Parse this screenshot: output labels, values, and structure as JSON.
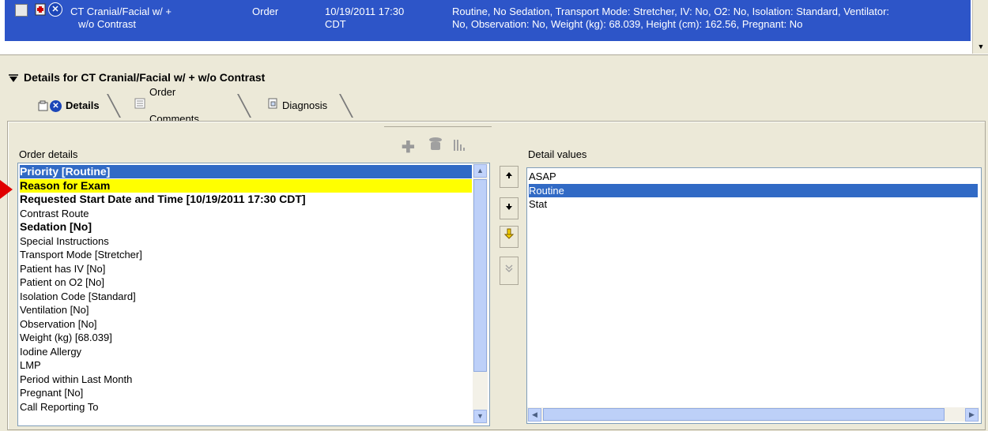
{
  "order_row": {
    "name_line1": "CT Cranial/Facial w/ +",
    "name_line2": "w/o Contrast",
    "type": "Order",
    "datetime_line1": "10/19/2011 17:30",
    "datetime_line2": "CDT",
    "summary_line1": "Routine, No Sedation, Transport Mode: Stretcher, IV: No, O2: No, Isolation: Standard, Ventilator:",
    "summary_line2": "No, Observation: No, Weight (kg): 68.039, Height (cm): 162.56, Pregnant: No"
  },
  "details": {
    "title": "Details for CT Cranial/Facial w/ + w/o Contrast",
    "tabs": [
      {
        "label": "Details",
        "icon": "details-icon"
      },
      {
        "label": "Order Comments",
        "icon": "comments-icon"
      },
      {
        "label": "Diagnosis",
        "icon": "diagnosis-icon"
      }
    ]
  },
  "order_details": {
    "label": "Order details",
    "items": [
      {
        "text": "Priority   [Routine]",
        "bold": true,
        "state": "selected"
      },
      {
        "text": "Reason for Exam",
        "bold": true,
        "state": "required"
      },
      {
        "text": "Requested Start Date and Time   [10/19/2011 17:30 CDT]",
        "bold": true,
        "state": ""
      },
      {
        "text": "Contrast Route",
        "bold": false,
        "state": ""
      },
      {
        "text": "Sedation   [No]",
        "bold": true,
        "state": ""
      },
      {
        "text": "Special Instructions",
        "bold": false,
        "state": ""
      },
      {
        "text": "Transport Mode   [Stretcher]",
        "bold": false,
        "state": ""
      },
      {
        "text": "Patient has IV   [No]",
        "bold": false,
        "state": ""
      },
      {
        "text": "Patient on O2   [No]",
        "bold": false,
        "state": ""
      },
      {
        "text": "Isolation Code   [Standard]",
        "bold": false,
        "state": ""
      },
      {
        "text": "Ventilation   [No]",
        "bold": false,
        "state": ""
      },
      {
        "text": "Observation   [No]",
        "bold": false,
        "state": ""
      },
      {
        "text": "Weight (kg)   [68.039]",
        "bold": false,
        "state": ""
      },
      {
        "text": "Iodine Allergy",
        "bold": false,
        "state": ""
      },
      {
        "text": "LMP",
        "bold": false,
        "state": ""
      },
      {
        "text": "Period within Last Month",
        "bold": false,
        "state": ""
      },
      {
        "text": "Pregnant   [No]",
        "bold": false,
        "state": ""
      },
      {
        "text": "Call Reporting To",
        "bold": false,
        "state": ""
      }
    ]
  },
  "detail_values": {
    "label": "Detail values",
    "items": [
      {
        "text": "ASAP",
        "state": ""
      },
      {
        "text": "Routine",
        "state": "selected"
      },
      {
        "text": "Stat",
        "state": ""
      }
    ]
  },
  "colors": {
    "order_row_bg": "#2d55c8",
    "selection_blue": "#316ac5",
    "required_yellow": "#ffff00",
    "panel_bg": "#ece9d8"
  }
}
